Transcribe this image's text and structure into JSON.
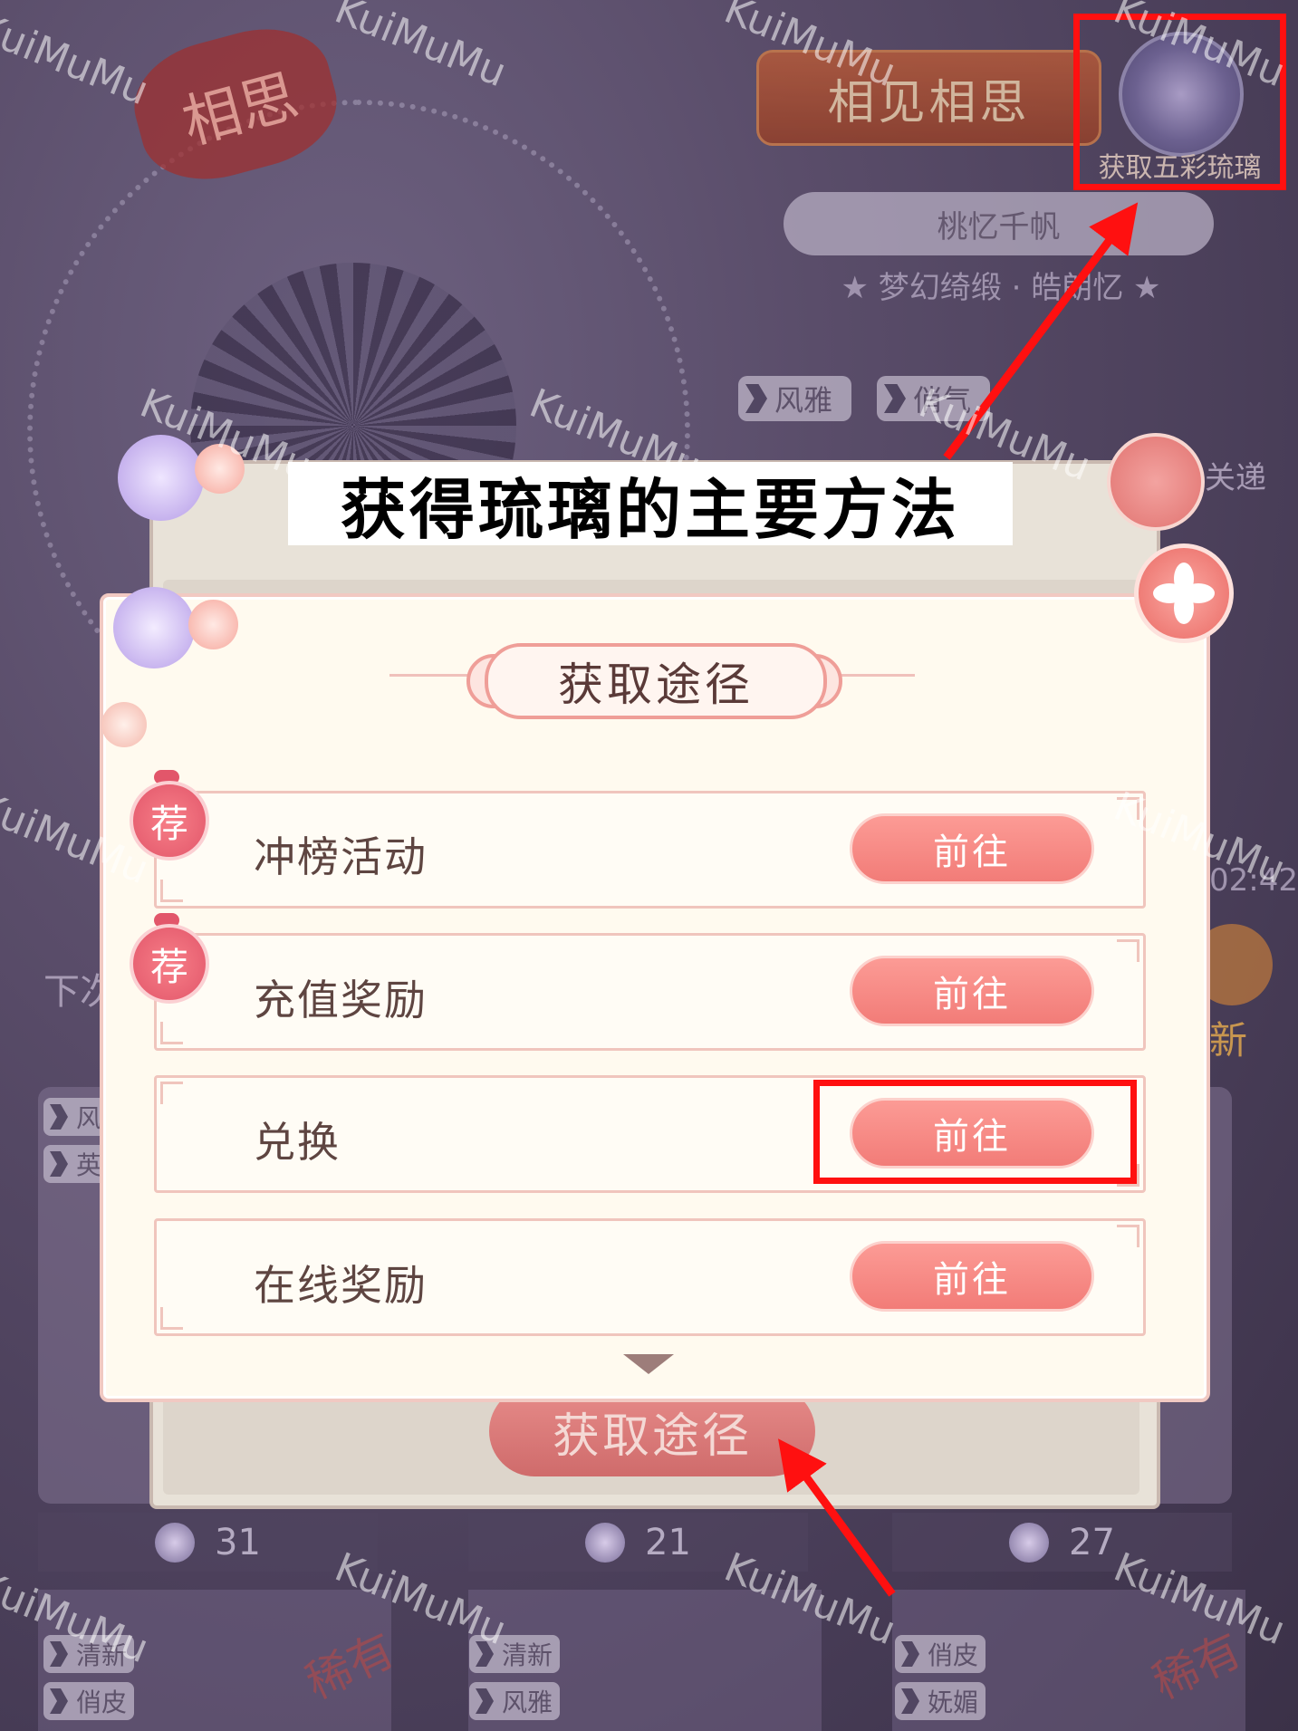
{
  "background": {
    "banner_text": "相思",
    "event_title": "相见相思",
    "currency_button_label": "获取五彩琉璃",
    "outfit_name": "桃忆千帆",
    "outfit_subtitle": "★ 梦幻绮缎 · 皓朗忆 ★",
    "style_tags": [
      "风雅",
      "俏气"
    ],
    "side_text_right": "关递",
    "side_text_left": "下次",
    "timer_text": "02:42",
    "side_badge_text": "新",
    "card_tags_left": [
      "风",
      "英"
    ],
    "card_counts": [
      "31",
      "21",
      "27"
    ],
    "bottom_tags": [
      [
        "清新",
        "俏皮"
      ],
      [
        "清新",
        "风雅"
      ],
      [
        "俏皮",
        "妩媚"
      ]
    ],
    "bottom_stamp_text": "稀有"
  },
  "back_panel": {
    "button_label": "获取途径"
  },
  "annotation": {
    "title": "获得琉璃的主要方法",
    "watermark": "KuiMuMu"
  },
  "dialog": {
    "title": "获取途径",
    "recommend_badge": "荐",
    "rows": [
      {
        "label": "冲榜活动",
        "button": "前往",
        "recommended": true
      },
      {
        "label": "充值奖励",
        "button": "前往",
        "recommended": true
      },
      {
        "label": "兑换",
        "button": "前往",
        "recommended": false
      },
      {
        "label": "在线奖励",
        "button": "前往",
        "recommended": false
      }
    ]
  },
  "colors": {
    "accent": "#f27c78",
    "annotation_red": "#ff1010",
    "dialog_bg": "#fffaef"
  }
}
